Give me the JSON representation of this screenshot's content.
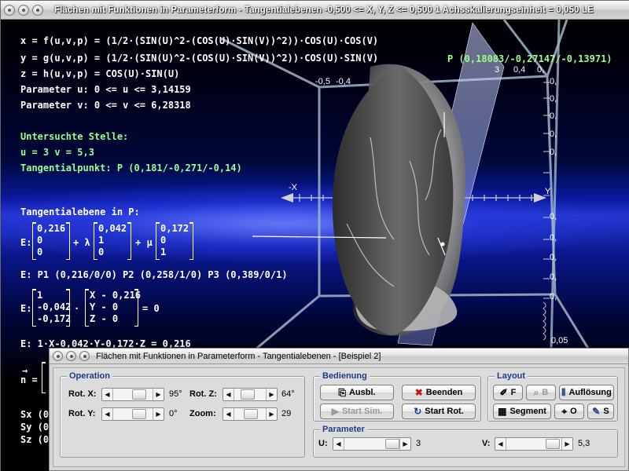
{
  "window": {
    "title": "Flächen mit Funktionen in Parameterform - Tangentialebenen   -0,500 <= X, Y, Z <= 0,500    1 Achsskalierungseinheit = 0,050 LE"
  },
  "formulas": {
    "x": "x = f(u,v,p) = (1/2·(SIN(U)^2-(COS(U)·SIN(V))^2))·COS(U)·COS(V)",
    "y": "y = g(u,v,p) = (1/2·(SIN(U)^2-(COS(U)·SIN(V))^2))·COS(U)·SIN(V)",
    "z": "z = h(u,v,p) = COS(U)·SIN(U)",
    "param_u": "Parameter u: 0 <= u <= 3,14159",
    "param_v": "Parameter v: 0 <= v <= 6,28318"
  },
  "stelle": {
    "heading": "Untersuchte Stelle:",
    "uv": "u = 3 v = 5,3",
    "point": "Tangentialpunkt: P (0,181/-0,271/-0,14)"
  },
  "plane": {
    "heading": "Tangentialebene in P:",
    "e_label": "E:",
    "plus_lambda": "+ λ",
    "plus_mu": "+ μ",
    "vec_p": [
      "0,216",
      "0",
      "0"
    ],
    "vec_a": [
      "0,042",
      "1",
      "0"
    ],
    "vec_b": [
      "0,172",
      "0",
      "1"
    ],
    "points_line": "E: P1 (0,216/0/0)   P2 (0,258/1/0)   P3 (0,389/0/1)",
    "normal": [
      "1",
      "-0,042",
      "-0,172"
    ],
    "diff": [
      "X - 0,216",
      "Y - 0",
      "Z - 0"
    ],
    "dot": "·",
    "eq_zero": "= 0",
    "coord_line": "E: 1·X-0,042·Y-0,172·Z = 0,216",
    "n_arrow": "→",
    "n_label": "n =",
    "sx": "Sx (0,",
    "sy": "Sy (0,",
    "sz": "Sz (0,"
  },
  "scene": {
    "point_label": "P (0,18083/-0,27147/-0,13971)",
    "axis_x_label": "-X",
    "axis_y_label": "Y",
    "top_ticks": [
      "-0,5",
      "-0,4"
    ],
    "right_ticks_top": [
      "3",
      "0,4",
      "0,"
    ],
    "right_scale": [
      "0,",
      "0,",
      "0,",
      "0,",
      "0,",
      "0,",
      "0,",
      "0,",
      "0,",
      "0,",
      "0,",
      "0,",
      "0,",
      "0,",
      "0,",
      "0,",
      "0,05",
      "0,05"
    ],
    "right_scale_last": "0,05"
  },
  "ctrl": {
    "title": "Flächen mit Funktionen in Parameterform - Tangentialebenen - [Beispiel 2]",
    "operation": {
      "label": "Operation",
      "rot_x": "Rot. X:",
      "rot_x_val": "95°",
      "rot_y": "Rot. Y:",
      "rot_y_val": "0°",
      "rot_z": "Rot. Z:",
      "rot_z_val": "64°",
      "zoom": "Zoom:",
      "zoom_val": "29"
    },
    "bedienung": {
      "label": "Bedienung",
      "ausbl": "Ausbl.",
      "beenden": "Beenden",
      "start_sim": "Start Sim.",
      "start_rot": "Start Rot."
    },
    "layout": {
      "label": "Layout",
      "f": "F",
      "b": "B",
      "aufloesung": "Auflösung",
      "segment": "Segment",
      "o": "O",
      "s": "S"
    },
    "parameter": {
      "label": "Parameter",
      "u": "U:",
      "u_val": "3",
      "v": "V:",
      "v_val": "5,3"
    }
  },
  "colors": {
    "accent_green": "#9cff8a",
    "group_label": "#1f3a8c",
    "sky_blue": "#2536d0"
  }
}
